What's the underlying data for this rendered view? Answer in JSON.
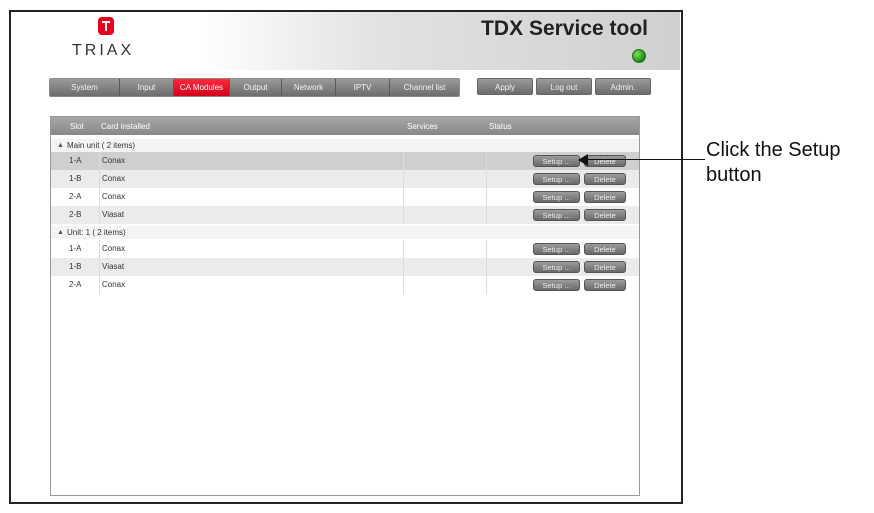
{
  "app": {
    "logo_text": "TRIAX",
    "title": "TDX Service tool"
  },
  "nav": {
    "tabs": [
      {
        "label": "System"
      },
      {
        "label": "Input"
      },
      {
        "label": "CA Modules"
      },
      {
        "label": "Output"
      },
      {
        "label": "Network"
      },
      {
        "label": "IPTV"
      },
      {
        "label": "Channel list"
      }
    ],
    "active_tab": "CA Modules"
  },
  "actions": {
    "apply": "Apply",
    "logout": "Log out",
    "admin": "Admin."
  },
  "grid": {
    "columns": [
      "Slot",
      "Card installed",
      "Services",
      "Status"
    ],
    "groups": [
      {
        "label": "Main unit ( 2 items)",
        "rows": [
          {
            "slot": "1-A",
            "card": "Conax"
          },
          {
            "slot": "1-B",
            "card": "Conax"
          },
          {
            "slot": "2-A",
            "card": "Conax"
          },
          {
            "slot": "2-B",
            "card": "Viasat"
          }
        ]
      },
      {
        "label": "Unit: 1 ( 2 items)",
        "rows": [
          {
            "slot": "1-A",
            "card": "Conax"
          },
          {
            "slot": "1-B",
            "card": "Viasat"
          },
          {
            "slot": "2-A",
            "card": "Conax"
          }
        ]
      }
    ],
    "setup_label": "Setup ...",
    "delete_label": "Delete"
  },
  "callout": {
    "text": "Click the Setup button"
  },
  "colors": {
    "brand_red": "#e8001c",
    "status_led": "#2fb51d",
    "button_gray": "#7a7a7a"
  },
  "icons": [
    "triax-logo-icon",
    "status-led-icon",
    "collapse-triangle-icon",
    "arrow-icon"
  ]
}
